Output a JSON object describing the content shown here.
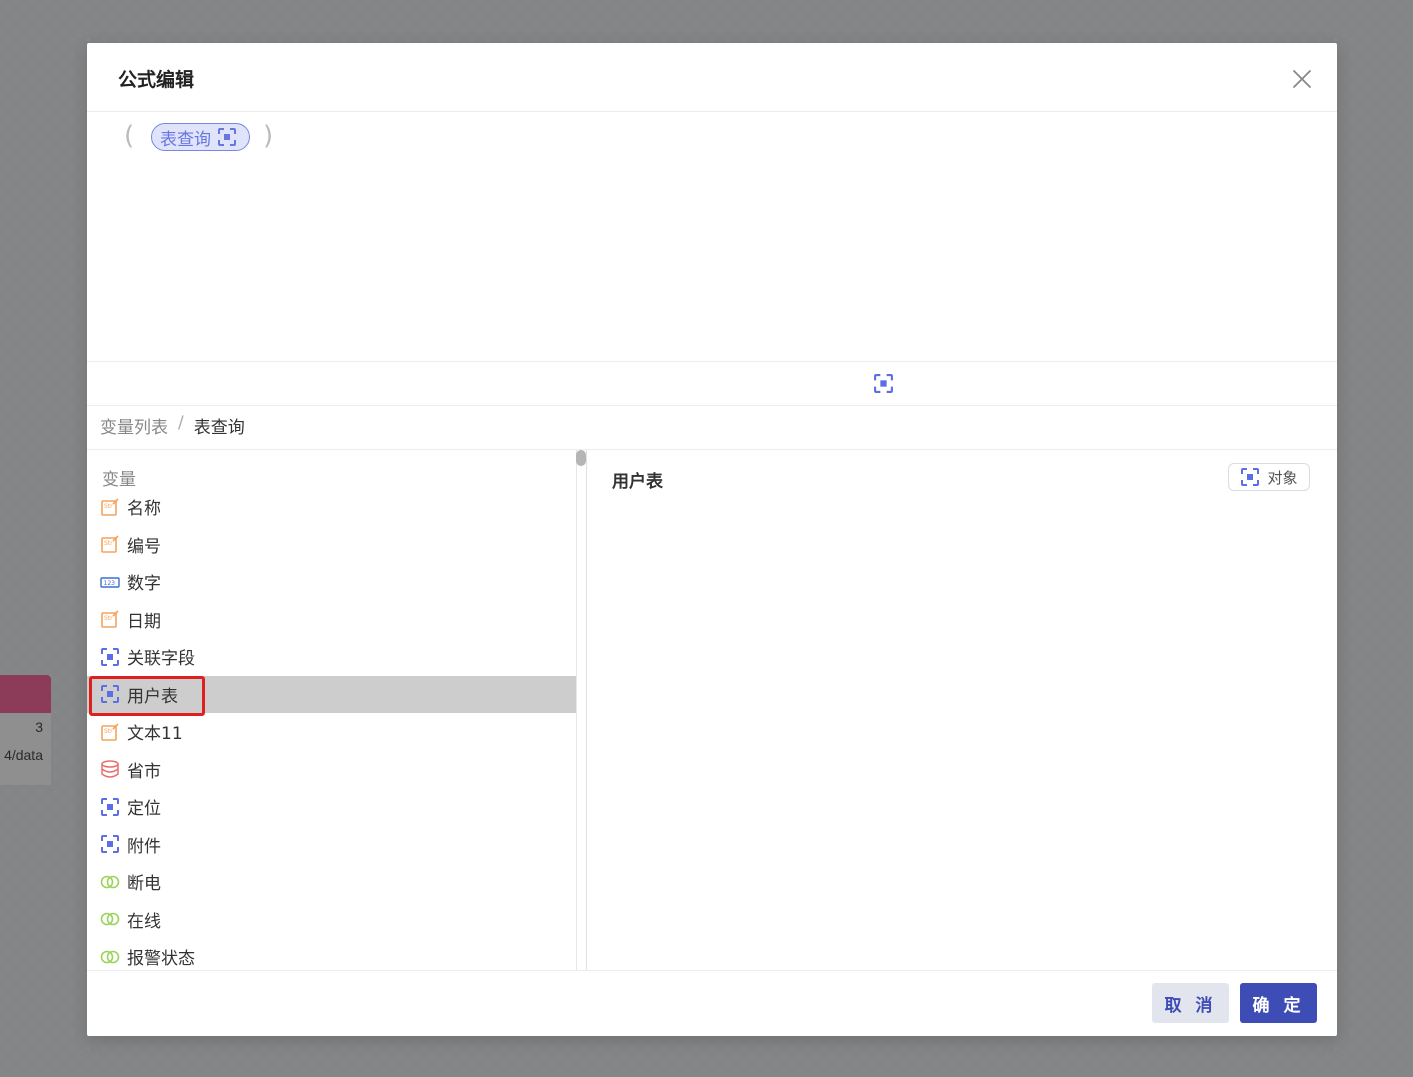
{
  "background_node": {
    "line1": "3",
    "line2": "4/data"
  },
  "dialog": {
    "title": "公式编辑",
    "close_icon": "close-icon",
    "formula": {
      "open_paren": "(",
      "close_paren": ")",
      "chip_label": "表查询",
      "chip_icon": "object-icon"
    }
  },
  "toolbar": {
    "icon": "object-icon"
  },
  "breadcrumb": {
    "root": "变量列表",
    "separator": "/",
    "current": "表查询"
  },
  "variables": {
    "heading": "变量",
    "items": [
      {
        "label": "名称",
        "icon": "string-icon"
      },
      {
        "label": "编号",
        "icon": "string-icon"
      },
      {
        "label": "数字",
        "icon": "number-icon"
      },
      {
        "label": "日期",
        "icon": "string-icon"
      },
      {
        "label": "关联字段",
        "icon": "object-icon"
      },
      {
        "label": "用户表",
        "icon": "object-icon",
        "selected": true
      },
      {
        "label": "文本11",
        "icon": "string-icon"
      },
      {
        "label": "省市",
        "icon": "database-icon"
      },
      {
        "label": "定位",
        "icon": "object-icon"
      },
      {
        "label": "附件",
        "icon": "object-icon"
      },
      {
        "label": "断电",
        "icon": "boolean-icon"
      },
      {
        "label": "在线",
        "icon": "boolean-icon"
      },
      {
        "label": "报警状态",
        "icon": "boolean-icon"
      }
    ]
  },
  "detail": {
    "title": "用户表",
    "type_label": "对象",
    "type_icon": "object-icon"
  },
  "footer": {
    "cancel_label": "取 消",
    "ok_label": "确 定"
  },
  "colors": {
    "primary": "#3e4cb5",
    "chip_bg": "#dfe4fb",
    "chip_border": "#7a85e8",
    "selected_row": "#cdcdcd",
    "highlight": "#e02020",
    "string_icon": "#f5a25d",
    "number_icon": "#3b6fd4",
    "object_icon": "#5b6ee8",
    "database_icon": "#e8706a",
    "boolean_icon": "#9bd35a"
  }
}
